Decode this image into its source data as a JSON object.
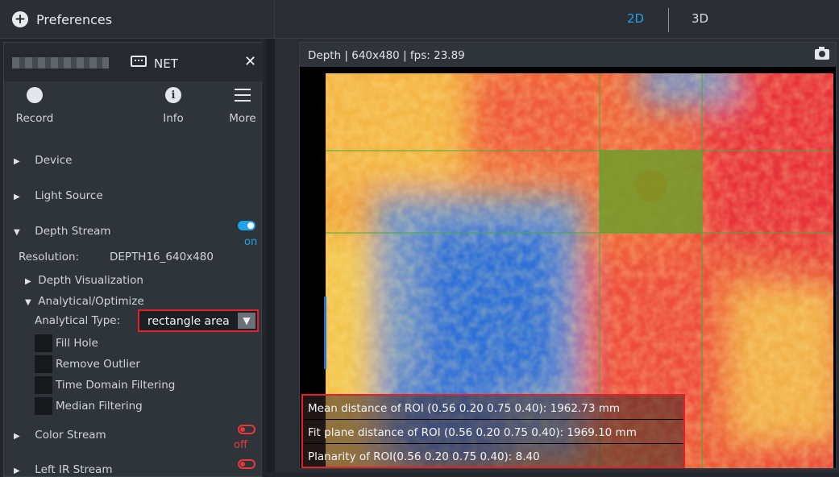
{
  "topbar": {
    "preferences_label": "Preferences",
    "tab_2d": "2D",
    "tab_3d": "3D",
    "active_tab": "2D"
  },
  "device": {
    "connection_label": "NET",
    "toolbar": {
      "record_label": "Record",
      "info_label": "Info",
      "more_label": "More"
    },
    "sections": [
      {
        "label": "Device"
      },
      {
        "label": "Light Source"
      },
      {
        "label": "Depth Stream",
        "state": "on"
      },
      {
        "label": "Color Stream",
        "state": "off"
      },
      {
        "label": "Left IR Stream"
      }
    ],
    "depth": {
      "resolution_label": "Resolution:",
      "resolution_value": "DEPTH16_640x480",
      "visualization_label": "Depth Visualization",
      "analytical_label": "Analytical/Optimize",
      "analytical_type_label": "Analytical Type:",
      "analytical_type_value": "rectangle area",
      "options": [
        {
          "label": "Fill Hole",
          "checked": false
        },
        {
          "label": "Remove Outlier",
          "checked": false
        },
        {
          "label": "Time Domain Filtering",
          "checked": false
        },
        {
          "label": "Median Filtering",
          "checked": false
        }
      ]
    }
  },
  "viewer": {
    "title": "Depth | 640x480 | fps: 23.89",
    "roi_lines": [
      "Mean distance of ROI (0.56 0.20 0.75 0.40): 1962.73   mm",
      "Fit plane distance of ROI (0.56 0.20 0.75 0.40): 1969.10   mm",
      "Planarity of ROI(0.56 0.20 0.75 0.40): 8.40"
    ]
  },
  "colors": {
    "accent": "#1ea3e6",
    "alert": "#e0222a",
    "off": "#e53a3a"
  }
}
